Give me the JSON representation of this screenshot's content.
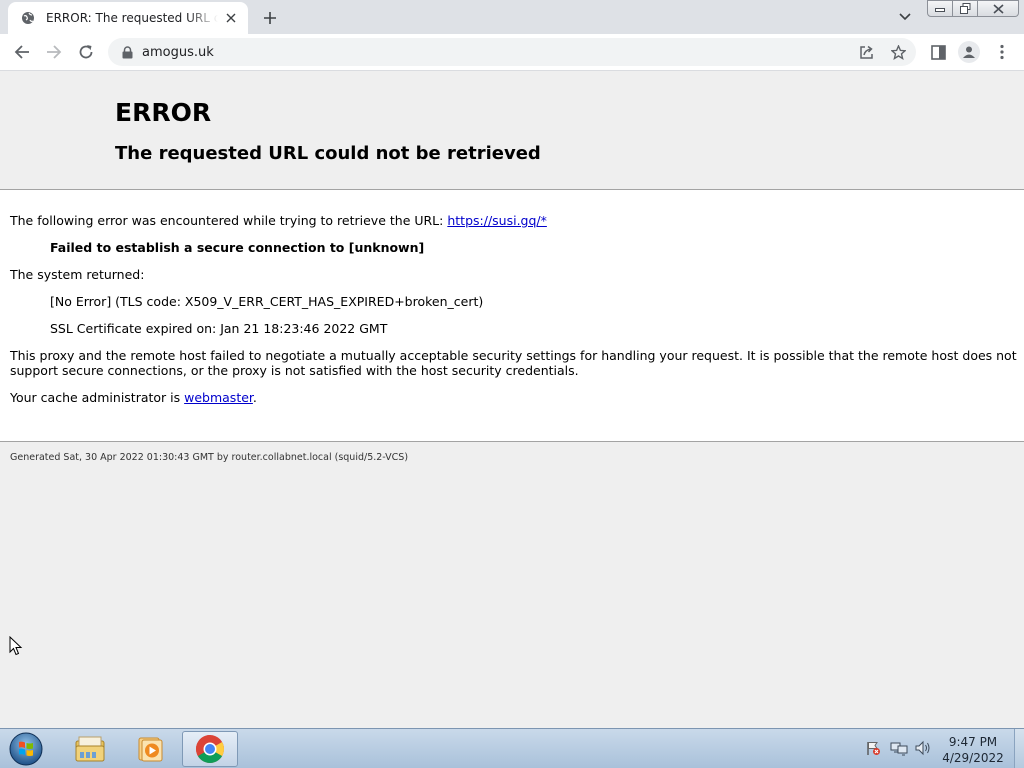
{
  "browser": {
    "tab": {
      "title": "ERROR: The requested URL could not be retrieved"
    },
    "url": "amogus.uk"
  },
  "page": {
    "title": "ERROR",
    "subtitle": "The requested URL could not be retrieved",
    "intro": "The following error was encountered while trying to retrieve the URL: ",
    "error_url": "https://susi.gq/*",
    "failure": "Failed to establish a secure connection to [unknown]",
    "system_returned": "The system returned:",
    "tls_error": "[No Error] (TLS code: X509_V_ERR_CERT_HAS_EXPIRED+broken_cert)",
    "ssl_expired": "SSL Certificate expired on: Jan 21 18:23:46 2022 GMT",
    "explanation_1": "This proxy and the remote host failed to negotiate a mutually acceptable security settings for handling your request. It is possible that the remote host does not",
    "explanation_2": "support secure connections, or the proxy is not satisfied with the host security credentials.",
    "admin_prefix": "Your cache administrator is ",
    "admin_link": "webmaster",
    "admin_suffix": ".",
    "footer": "Generated Sat, 30 Apr 2022 01:30:43 GMT by router.collabnet.local (squid/5.2-VCS)"
  },
  "taskbar": {
    "time": "9:47 PM",
    "date": "4/29/2022",
    "apps": [
      {
        "icon": "file-explorer-icon"
      },
      {
        "icon": "media-player-icon"
      },
      {
        "icon": "chrome-icon"
      }
    ]
  },
  "colors": {
    "link": "#0000cc",
    "page_background": "#efefef",
    "content_background": "#ffffff"
  }
}
